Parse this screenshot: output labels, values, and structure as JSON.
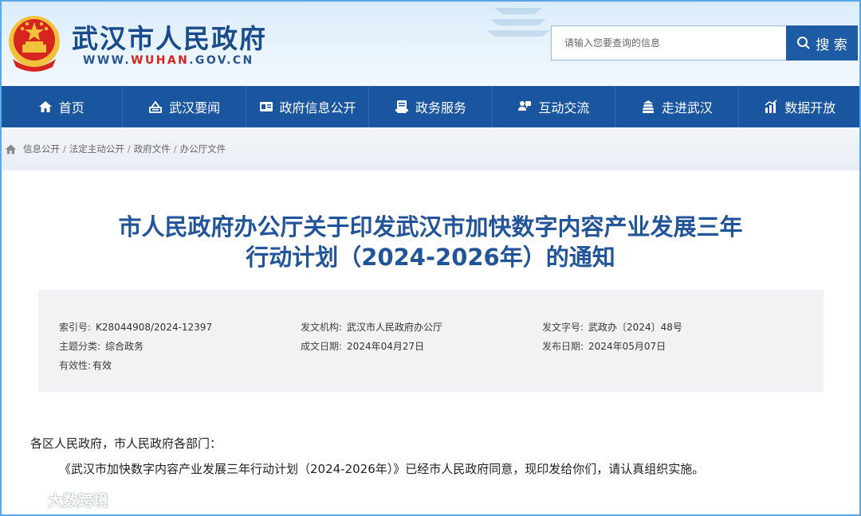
{
  "header": {
    "site_name": "武汉市人民政府",
    "url_prefix": "WWW.",
    "url_highlight": "WUHAN",
    "url_suffix": ".GOV.CN",
    "search_placeholder": "请输入您要查询的信息",
    "search_label": "搜 索"
  },
  "nav": {
    "items": [
      {
        "label": "首页",
        "icon": "home-icon"
      },
      {
        "label": "武汉要闻",
        "icon": "news-icon"
      },
      {
        "label": "政府信息公开",
        "icon": "info-card-icon"
      },
      {
        "label": "政务服务",
        "icon": "service-icon"
      },
      {
        "label": "互动交流",
        "icon": "chat-icon"
      },
      {
        "label": "走进武汉",
        "icon": "building-icon"
      },
      {
        "label": "数据开放",
        "icon": "chart-icon"
      }
    ]
  },
  "breadcrumb": [
    "信息公开",
    "法定主动公开",
    "政府文件",
    "办公厅文件"
  ],
  "title": {
    "line1": "市人民政府办公厅关于印发武汉市加快数字内容产业发展三年",
    "line2": "行动计划（2024-2026年）的通知"
  },
  "meta": {
    "index_no": {
      "k": "索引号:",
      "v": "K28044908/2024-12397"
    },
    "issuer": {
      "k": "发文机构:",
      "v": "武汉市人民政府办公厅"
    },
    "doc_no": {
      "k": "发文字号:",
      "v": "武政办〔2024〕48号"
    },
    "category": {
      "k": "主题分类:",
      "v": "综合政务"
    },
    "written_date": {
      "k": "成文日期:",
      "v": "2024年04月27日"
    },
    "publish_date": {
      "k": "发布日期:",
      "v": "2024年05月07日"
    },
    "validity": {
      "k": "有效性:",
      "v": "有效"
    }
  },
  "body": {
    "salutation": "各区人民政府，市人民政府各部门：",
    "paragraph": "《武汉市加快数字内容产业发展三年行动计划（2024-2026年）》已经市人民政府同意，现印发给你们，请认真组织实施。"
  },
  "watermark": "大数跨境",
  "colors": {
    "brand_blue": "#1a56a0",
    "title_blue": "#22549a",
    "emblem_red": "#d6241f",
    "emblem_gold": "#f2c13b"
  }
}
